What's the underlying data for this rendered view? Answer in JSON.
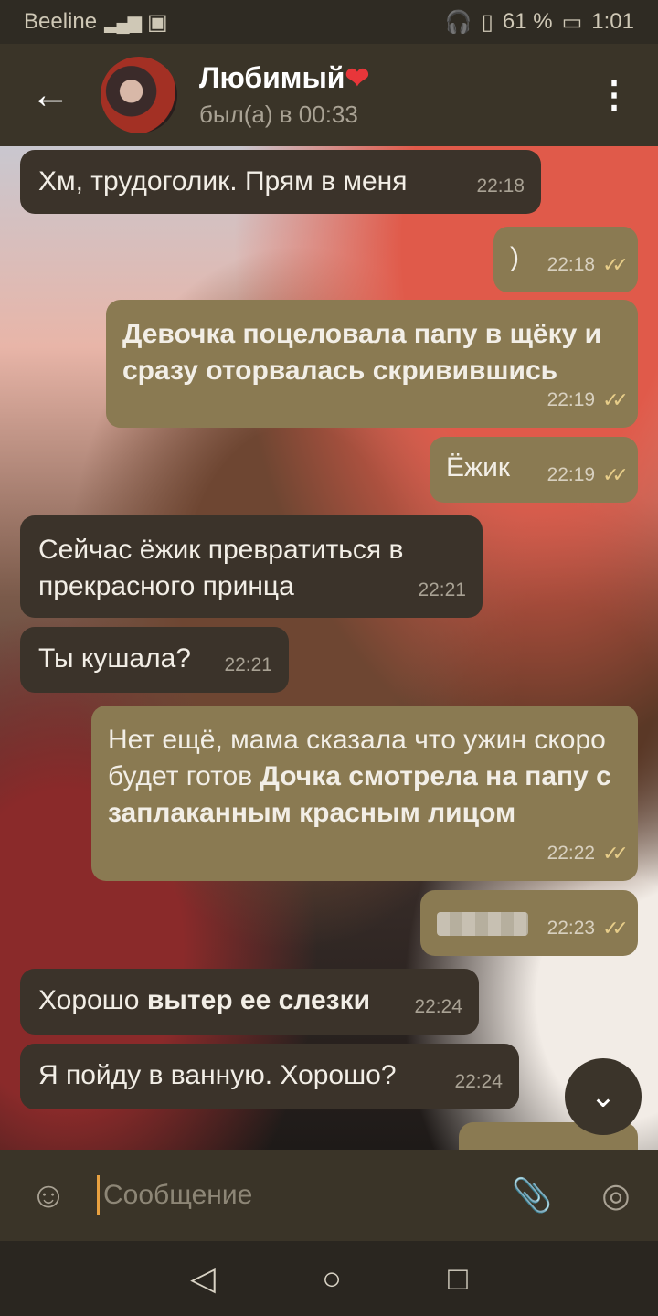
{
  "status": {
    "carrier": "Beeline",
    "net": "4G",
    "battery": "61 %",
    "time": "1:01"
  },
  "header": {
    "name": "Любимый",
    "heart": "❤",
    "status": "был(а) в 00:33"
  },
  "messages": [
    {
      "dir": "in",
      "text": "Хм, трудоголик. Прям в меня",
      "time": "22:18"
    },
    {
      "dir": "out",
      "text": ")",
      "time": "22:18"
    },
    {
      "dir": "out",
      "text_bold": "Девочка поцеловала папу в щёку и сразу оторвалась скривившись",
      "time": "22:19"
    },
    {
      "dir": "out",
      "text": "Ёжик",
      "time": "22:19"
    },
    {
      "dir": "in",
      "text": "Сейчас ёжик превратиться в прекрасного принца",
      "time": "22:21"
    },
    {
      "dir": "in",
      "text": "Ты кушала?",
      "time": "22:21"
    },
    {
      "dir": "out",
      "text": "Нет ещё, мама сказала что ужин скоро будет готов",
      "text_bold": "Дочка смотрела на папу с заплаканным красным лицом",
      "time": "22:22"
    },
    {
      "dir": "out",
      "text": "",
      "time": "22:23"
    },
    {
      "dir": "in",
      "text": "Хорошо",
      "text_bold": "вытер ее слезки",
      "time": "22:24"
    },
    {
      "dir": "in",
      "text": "Я пойду в ванную. Хорошо?",
      "time": "22:24"
    }
  ],
  "input": {
    "placeholder": "Сообщение"
  },
  "icons": {
    "back": "arrow-left-icon",
    "menu": "more-vert-icon",
    "emoji": "smile-icon",
    "attach": "paperclip-icon",
    "camera": "camera-icon"
  }
}
